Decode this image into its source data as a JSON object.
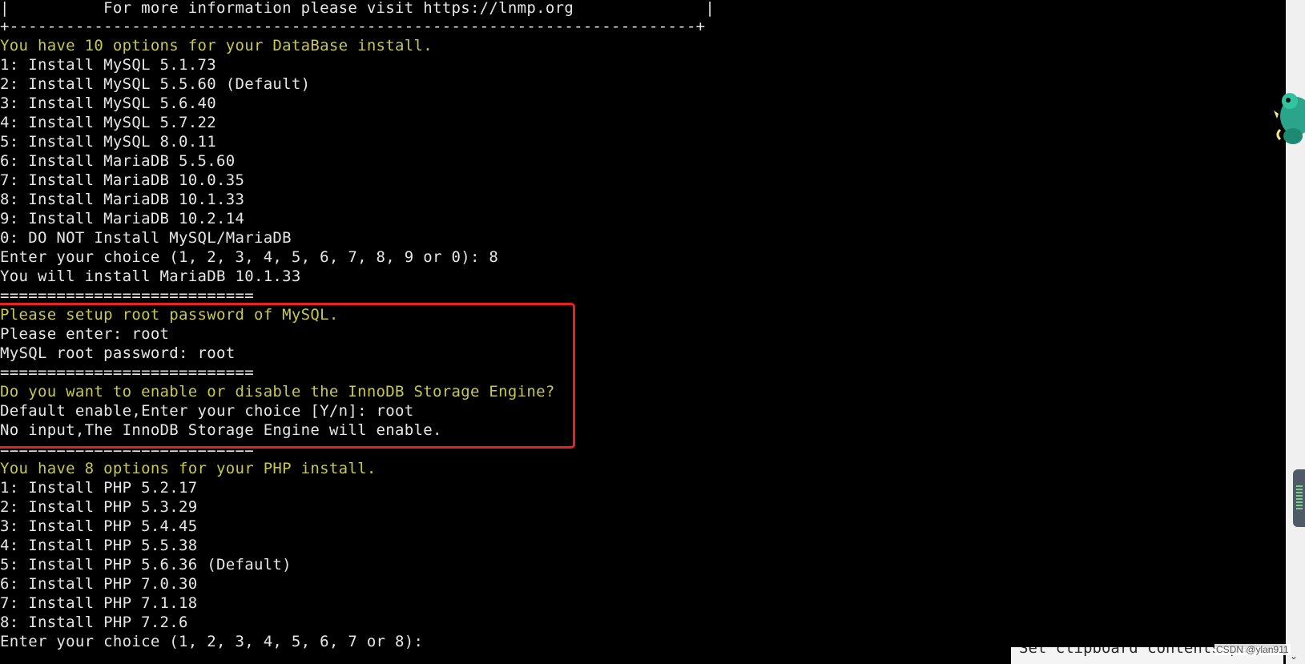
{
  "terminal": {
    "header_info": "|          For more information please visit https://lnmp.org              |",
    "separator_plus": "+-------------------------------------------------------------------------+",
    "db_intro": "You have 10 options for your DataBase install.",
    "db_options": [
      "1: Install MySQL 5.1.73",
      "2: Install MySQL 5.5.60 (Default)",
      "3: Install MySQL 5.6.40",
      "4: Install MySQL 5.7.22",
      "5: Install MySQL 8.0.11",
      "6: Install MariaDB 5.5.60",
      "7: Install MariaDB 10.0.35",
      "8: Install MariaDB 10.1.33",
      "9: Install MariaDB 10.2.14",
      "0: DO NOT Install MySQL/MariaDB"
    ],
    "db_prompt": "Enter your choice (1, 2, 3, 4, 5, 6, 7, 8, 9 or 0): 8",
    "db_result": "You will install MariaDB 10.1.33",
    "separator_eq": "===========================",
    "password_title": "Please setup root password of MySQL.",
    "password_enter": "Please enter: root",
    "password_result": "MySQL root password: root",
    "innodb_question": "Do you want to enable or disable the InnoDB Storage Engine?",
    "innodb_prompt": "Default enable,Enter your choice [Y/n]: root",
    "innodb_result": "No input,The InnoDB Storage Engine will enable.",
    "php_intro": "You have 8 options for your PHP install.",
    "php_options": [
      "1: Install PHP 5.2.17",
      "2: Install PHP 5.3.29",
      "3: Install PHP 5.4.45",
      "4: Install PHP 5.5.38",
      "5: Install PHP 5.6.36 (Default)",
      "6: Install PHP 7.0.30",
      "7: Install PHP 7.1.18",
      "8: Install PHP 7.2.6"
    ],
    "php_prompt": "Enter your choice (1, 2, 3, 4, 5, 6, 7 or 8):"
  },
  "overlay": {
    "bottom_panel_text": "Set clipboard contents pasted",
    "watermark": "CSDN @ylan911",
    "mascot_icon": "dinosaur-mascot-icon",
    "chevron_icon": "chevron-down-icon"
  },
  "colors": {
    "background": "#000000",
    "normal_text": "#e6e6e6",
    "highlight_text": "#c8c84a",
    "annotation_box": "#e8231e"
  }
}
